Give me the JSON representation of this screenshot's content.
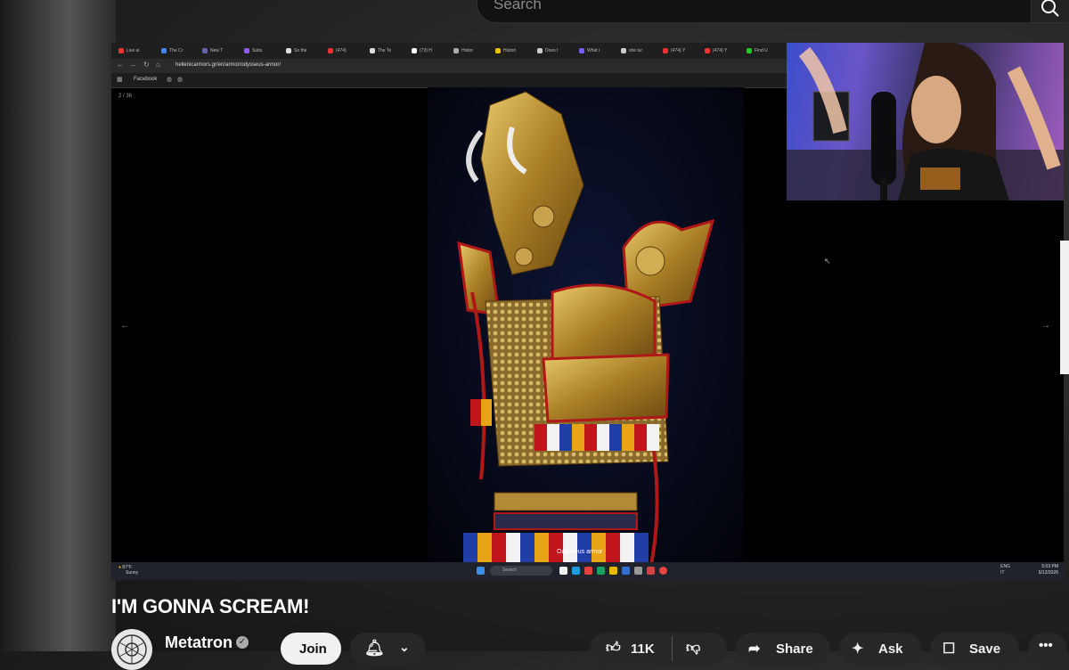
{
  "search": {
    "placeholder": "Search"
  },
  "browser": {
    "tabs": [
      "Live ai",
      "The Cr",
      "New T",
      "Subs",
      "So the",
      "(474)",
      "The Te",
      "(73) H",
      "Histor",
      "Histori",
      "Does t",
      "What i",
      "she lur",
      "(474) Y",
      "(474) Y",
      "Find U"
    ],
    "url": "hellenicarmors.gr/en/armor/odysseus-armor/",
    "bookmark": "Facebook",
    "image_counter": "2 / 36",
    "caption": "Odysseus armor",
    "taskbar": {
      "weather_temp": "87°F",
      "weather_desc": "Sunny",
      "search": "Search",
      "lang_top": "ENG",
      "lang_bottom": "IT",
      "time": "5:03 PM",
      "date": "5/12/2026"
    }
  },
  "video": {
    "title": "I'M GONNA SCREAM!",
    "channel": "Metatron",
    "join_label": "Join",
    "like_count": "11K",
    "share_label": "Share",
    "ask_label": "Ask",
    "save_label": "Save"
  },
  "colors": {
    "accent_red": "#c0161b",
    "gold": "#b8932f",
    "pill_bg": "#272727"
  }
}
